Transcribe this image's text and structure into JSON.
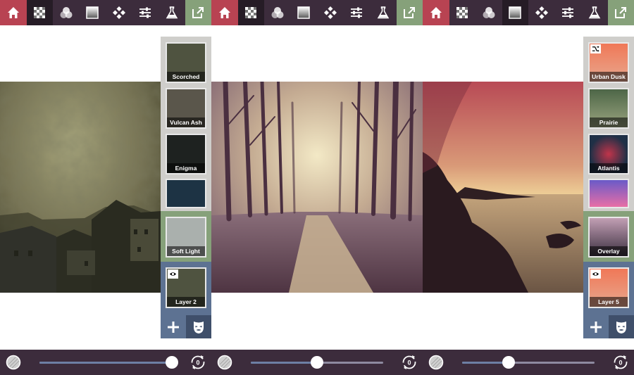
{
  "toolbar": {
    "items": [
      {
        "icon": "home-icon"
      },
      {
        "icon": "textures-icon"
      },
      {
        "icon": "colors-icon"
      },
      {
        "icon": "gradients-icon"
      },
      {
        "icon": "overlays-icon"
      },
      {
        "icon": "adjustments-icon"
      },
      {
        "icon": "lab-icon"
      },
      {
        "icon": "export-icon"
      }
    ],
    "colors": {
      "home": "#b84352",
      "export": "#86a17a",
      "bar": "#3c2c3c"
    }
  },
  "panels": [
    {
      "layers": [
        {
          "label": "Scorched"
        },
        {
          "label": "Vulcan Ash"
        },
        {
          "label": "Enigma"
        },
        {
          "label": ""
        },
        {
          "label": "Soft Light"
        },
        {
          "label": "Layer 2"
        }
      ],
      "opacity": 1.0
    },
    {
      "layers": [],
      "opacity": 0.5
    },
    {
      "layers": [
        {
          "label": "Urban Dusk"
        },
        {
          "label": "Prairie"
        },
        {
          "label": "Atlantis"
        },
        {
          "label": ""
        },
        {
          "label": "Overlay"
        },
        {
          "label": "Layer 5"
        }
      ],
      "opacity": 0.35
    }
  ],
  "reset_value": "0"
}
